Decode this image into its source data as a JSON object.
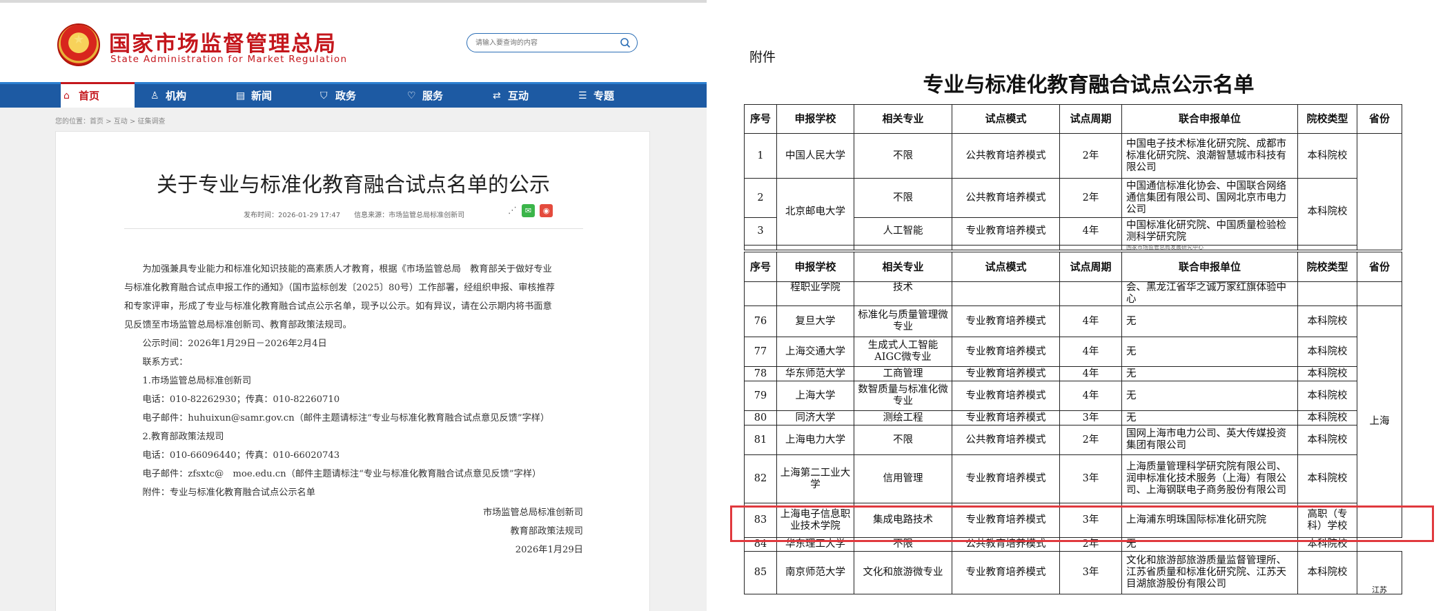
{
  "site": {
    "name_cn": "国家市场监督管理总局",
    "name_en": "State Administration for Market Regulation",
    "search_placeholder": "请输入要查询的内容"
  },
  "nav": {
    "items": [
      {
        "label": "首页",
        "icon": "home-icon"
      },
      {
        "label": "机构",
        "icon": "org-icon"
      },
      {
        "label": "新闻",
        "icon": "news-icon"
      },
      {
        "label": "政务",
        "icon": "gov-icon"
      },
      {
        "label": "服务",
        "icon": "heart-icon"
      },
      {
        "label": "互动",
        "icon": "exchange-icon"
      },
      {
        "label": "专题",
        "icon": "list-icon"
      }
    ]
  },
  "breadcrumb": "您的位置：首页 > 互动 > 征集调查",
  "article": {
    "title": "关于专业与标准化教育融合试点名单的公示",
    "meta": "发布时间：2026-01-29 17:47　　信息来源：市场监管总局标准创新司",
    "paragraphs": [
      "　　为加强兼具专业能力和标准化知识技能的高素质人才教育，根据《市场监管总局　教育部关于做好专业",
      "与标准化教育融合试点申报工作的通知》（国市监标创发〔2025〕80号）工作部署，经组织申报、审核推荐",
      "和专家评审，形成了专业与标准化教育融合试点公示名单，现予以公示。如有异议，请在公示期内将书面意",
      "见反馈至市场监管总局标准创新司、教育部政策法规司。",
      "　　公示时间：2026年1月29日－2026年2月4日",
      "　　联系方式：",
      "　　1.市场监管总局标准创新司",
      "　　电话：010-82262930；传真：010-82260710",
      "　　电子邮件：huhuixun@samr.gov.cn（邮件主题请标注“专业与标准化教育融合试点意见反馈”字样）",
      "　　2.教育部政策法规司",
      "　　电话：010-66096440；传真：010-66020743",
      "　　电子邮件：zfsxtc@　moe.edu.cn（邮件主题请标注“专业与标准化教育融合试点意见反馈”字样）",
      "　　附件：专业与标准化教育融合试点公示名单"
    ],
    "signatures": [
      "市场监管总局标准创新司",
      "教育部政策法规司",
      "2026年1月29日"
    ]
  },
  "attachment": {
    "label": "附件",
    "title": "专业与标准化教育融合试点公示名单",
    "headers": [
      "序号",
      "申报学校",
      "相关专业",
      "试点模式",
      "试点周期",
      "联合申报单位",
      "院校类型",
      "省份"
    ],
    "top_rows": [
      {
        "no": "1",
        "school": "中国人民大学",
        "major": "不限",
        "mode": "公共教育培养模式",
        "period": "2年",
        "partners": "中国电子技术标准化研究院、成都市标准化研究院、浪潮智慧城市科技有限公司",
        "type": "本科院校"
      },
      {
        "no": "2",
        "school": "北京邮电大学",
        "major": "不限",
        "mode": "公共教育培养模式",
        "period": "2年",
        "partners": "中国通信标准化协会、中国联合网络通信集团有限公司、国网北京市电力公司",
        "type": "本科院校"
      },
      {
        "no": "3",
        "school": "",
        "major": "人工智能",
        "mode": "专业教育培养模式",
        "period": "4年",
        "partners": "中国标准化研究院、中国质量检验检测科学研究院",
        "type": ""
      }
    ],
    "top_partial_text": "国家市场监管总局发展研究中心",
    "cont_row": {
      "school": "程职业学院",
      "major": "技术",
      "partners": "会、黑龙江省华之诚万家红旗体验中心"
    },
    "rows": [
      {
        "no": "76",
        "school": "复旦大学",
        "major": "标准化与质量管理微专业",
        "mode": "专业教育培养模式",
        "period": "4年",
        "partners": "无",
        "type": "本科院校"
      },
      {
        "no": "77",
        "school": "上海交通大学",
        "major": "生成式人工智能AIGC微专业",
        "mode": "专业教育培养模式",
        "period": "4年",
        "partners": "无",
        "type": "本科院校"
      },
      {
        "no": "78",
        "school": "华东师范大学",
        "major": "工商管理",
        "mode": "专业教育培养模式",
        "period": "4年",
        "partners": "无",
        "type": "本科院校"
      },
      {
        "no": "79",
        "school": "上海大学",
        "major": "数智质量与标准化微专业",
        "mode": "专业教育培养模式",
        "period": "4年",
        "partners": "无",
        "type": "本科院校"
      },
      {
        "no": "80",
        "school": "同济大学",
        "major": "测绘工程",
        "mode": "专业教育培养模式",
        "period": "3年",
        "partners": "无",
        "type": "本科院校"
      },
      {
        "no": "81",
        "school": "上海电力大学",
        "major": "不限",
        "mode": "公共教育培养模式",
        "period": "2年",
        "partners": "国网上海市电力公司、英大传媒投资集团有限公司",
        "type": "本科院校"
      },
      {
        "no": "82",
        "school": "上海第二工业大学",
        "major": "信用管理",
        "mode": "专业教育培养模式",
        "period": "3年",
        "partners": "上海质量管理科学研究院有限公司、润申标准化技术服务（上海）有限公司、上海钢联电子商务股份有限公司",
        "type": "本科院校"
      },
      {
        "no": "83",
        "school": "上海电子信息职业技术学院",
        "major": "集成电路技术",
        "mode": "专业教育培养模式",
        "period": "3年",
        "partners": "上海浦东明珠国际标准化研究院",
        "type": "高职（专科）学校"
      },
      {
        "no": "84",
        "school": "华东理工大学",
        "major": "不限",
        "mode": "公共教育培养模式",
        "period": "2年",
        "partners": "无",
        "type": "本科院校"
      },
      {
        "no": "85",
        "school": "南京师范大学",
        "major": "文化和旅游微专业",
        "mode": "专业教育培养模式",
        "period": "3年",
        "partners": "文化和旅游部旅游质量监督管理所、江苏省质量和标准化研究院、江苏天目湖旅游股份有限公司",
        "type": "本科院校"
      }
    ],
    "province_shanghai": "上海",
    "province_next": "江苏"
  }
}
